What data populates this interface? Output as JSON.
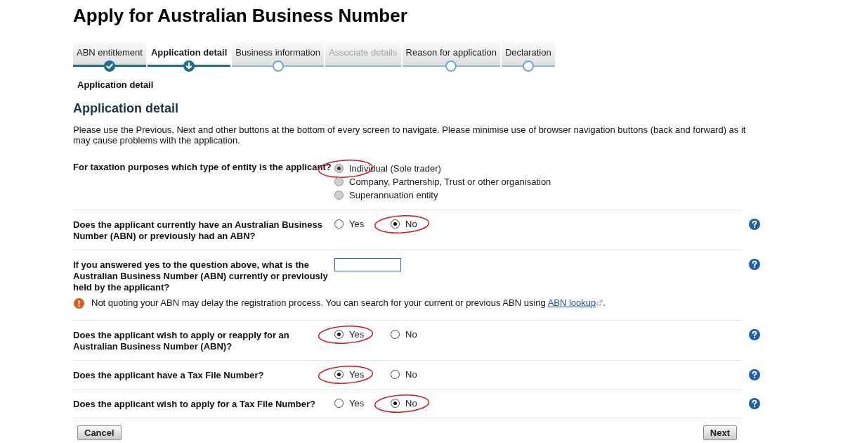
{
  "page_title": "Apply for Australian Business Number",
  "steps": [
    {
      "label": "ABN entitlement",
      "completed": true,
      "selected": false,
      "disabled": false
    },
    {
      "label": "Application detail",
      "completed": false,
      "selected": true,
      "disabled": false
    },
    {
      "label": "Business information",
      "completed": false,
      "selected": false,
      "disabled": false
    },
    {
      "label": "Associate details",
      "completed": false,
      "selected": false,
      "disabled": true
    },
    {
      "label": "Reason for application",
      "completed": false,
      "selected": false,
      "disabled": false
    },
    {
      "label": "Declaration",
      "completed": false,
      "selected": false,
      "disabled": false
    }
  ],
  "breadcrumb": "Application detail",
  "section_title": "Application detail",
  "intro": "Please use the Previous, Next and other buttons at the bottom of every screen to navigate. Please minimise use of browser navigation buttons (back and forward) as it may cause problems with the application.",
  "questions": [
    {
      "kind": "radio",
      "label": "For taxation purposes which type of entity is the applicant?",
      "disabled": true,
      "help": false,
      "options": [
        {
          "label": "Individual (Sole trader)",
          "selected": true,
          "circled": true
        },
        {
          "label": "Company, Partnership, Trust or other organisation",
          "selected": false,
          "circled": false
        },
        {
          "label": "Superannuation entity",
          "selected": false,
          "circled": false
        }
      ]
    },
    {
      "kind": "radio",
      "label": "Does the applicant currently have an Australian Business Number (ABN) or previously had an ABN?",
      "help": true,
      "options": [
        {
          "label": "Yes",
          "selected": false,
          "circled": false
        },
        {
          "label": "No",
          "selected": true,
          "circled": true
        }
      ]
    },
    {
      "kind": "text",
      "label": "If you answered yes to the question above, what is the Australian Business Number (ABN) currently or previously held by the applicant?",
      "help": true,
      "notice": {
        "text": "Not quoting your ABN may delay the registration process. You can search for your current or previous ABN using",
        "link": "ABN lookup",
        "end": "."
      }
    },
    {
      "kind": "radio",
      "label": "Does the applicant wish to apply or reapply for an Australian Business Number (ABN)?",
      "help": true,
      "options": [
        {
          "label": "Yes",
          "selected": true,
          "circled": true
        },
        {
          "label": "No",
          "selected": false,
          "circled": false
        }
      ]
    },
    {
      "kind": "radio",
      "label": "Does the applicant have a Tax File Number?",
      "help": true,
      "options": [
        {
          "label": "Yes",
          "selected": true,
          "circled": true
        },
        {
          "label": "No",
          "selected": false,
          "circled": false
        }
      ]
    },
    {
      "kind": "radio",
      "label": "Does the applicant wish to apply for a Tax File Number?",
      "help": true,
      "options": [
        {
          "label": "Yes",
          "selected": false,
          "circled": false
        },
        {
          "label": "No",
          "selected": true,
          "circled": true
        }
      ]
    }
  ],
  "buttons": [
    "Cancel",
    "Next"
  ]
}
